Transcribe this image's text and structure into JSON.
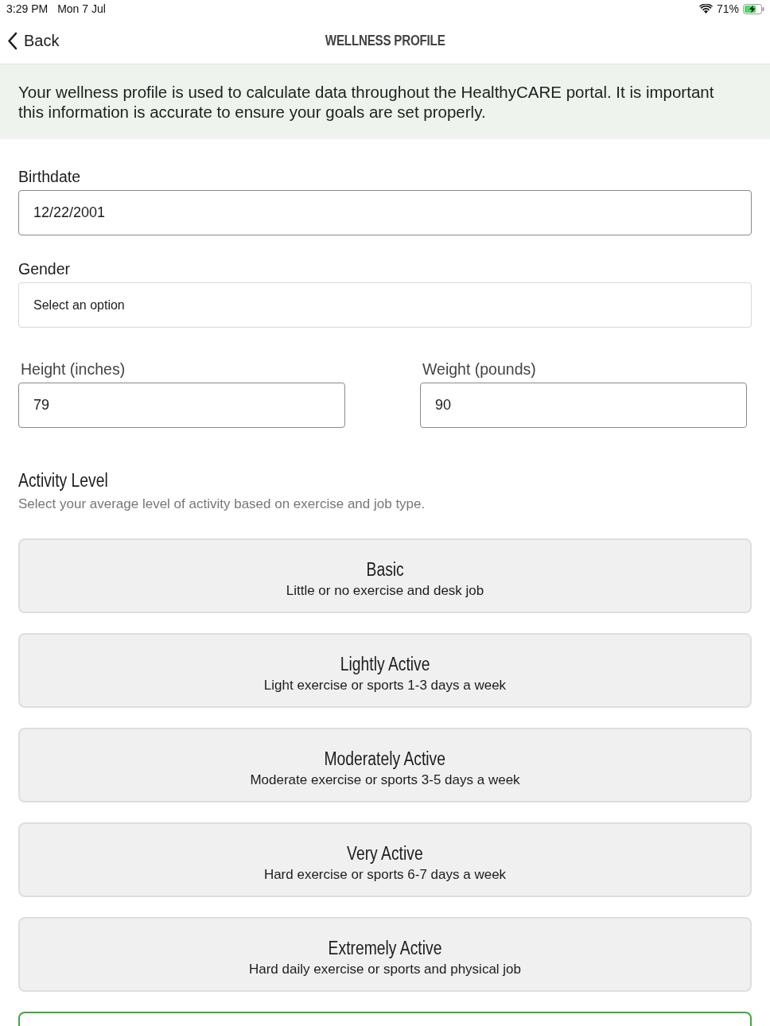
{
  "status_bar": {
    "time": "3:29 PM",
    "date": "Mon 7 Jul",
    "battery": "71%"
  },
  "nav_bar": {
    "back_label": "Back",
    "title": "WELLNESS PROFILE"
  },
  "info_banner": {
    "text": "Your wellness profile is used to calculate data throughout the HealthyCARE portal. It is important this information is accurate to ensure your goals are set properly."
  },
  "form": {
    "birthdate": {
      "label": "Birthdate",
      "value": "12/22/2001"
    },
    "gender": {
      "label": "Gender",
      "placeholder": "Select an option"
    },
    "height": {
      "label": "Height (inches)",
      "value": "79"
    },
    "weight": {
      "label": "Weight (pounds)",
      "value": "90"
    }
  },
  "activity_level": {
    "heading": "Activity Level",
    "description": "Select your average level of activity based on exercise and job type.",
    "options": [
      {
        "title": "Basic",
        "description": "Little or no exercise and desk job",
        "selected": false
      },
      {
        "title": "Lightly Active",
        "description": "Light exercise or sports 1-3 days a week",
        "selected": false
      },
      {
        "title": "Moderately Active",
        "description": "Moderate exercise or sports 3-5 days a week",
        "selected": false
      },
      {
        "title": "Very Active",
        "description": "Hard exercise or sports 6-7 days a week",
        "selected": false
      },
      {
        "title": "Extremely Active",
        "description": "Hard daily exercise or sports and physical job",
        "selected": false
      }
    ]
  }
}
